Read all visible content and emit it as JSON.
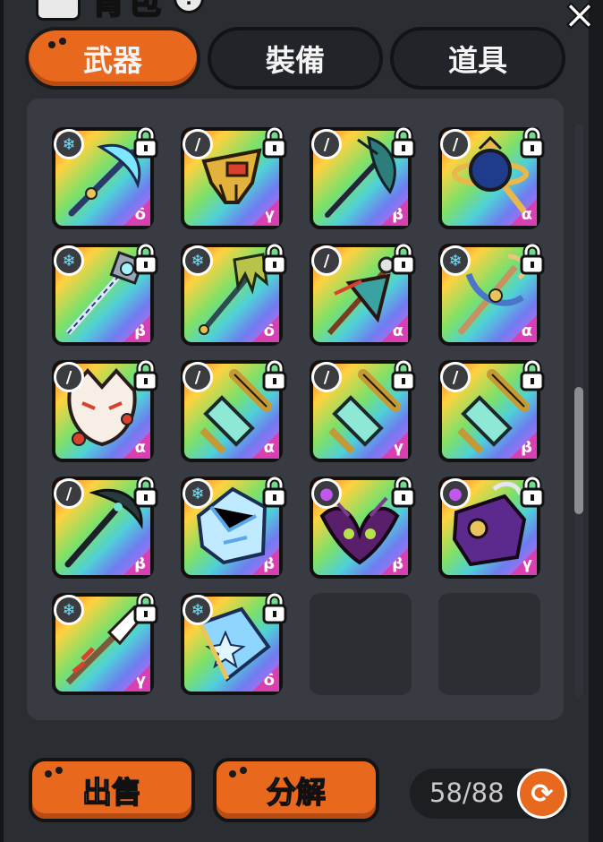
{
  "title": {
    "text": "背包",
    "info": "!"
  },
  "close": "×",
  "tabs": [
    {
      "label": "武器",
      "active": true
    },
    {
      "label": "裝備",
      "active": false
    },
    {
      "label": "道具",
      "active": false
    }
  ],
  "items": [
    {
      "icon": "ice-scythe",
      "type": "ice",
      "grade": "δ",
      "locked": true
    },
    {
      "icon": "golden-mask",
      "type": "physical",
      "grade": "γ",
      "locked": true
    },
    {
      "icon": "feather-staff",
      "type": "physical",
      "grade": "β",
      "locked": true
    },
    {
      "icon": "ringed-orb-staff",
      "type": "physical",
      "grade": "α",
      "locked": true
    },
    {
      "icon": "crystal-staff",
      "type": "ice",
      "grade": "β",
      "locked": true
    },
    {
      "icon": "claw-staff",
      "type": "ice",
      "grade": "δ",
      "locked": true
    },
    {
      "icon": "tribal-staff",
      "type": "physical",
      "grade": "α",
      "locked": true
    },
    {
      "icon": "anchor-staff",
      "type": "ice",
      "grade": "α",
      "locked": true
    },
    {
      "icon": "fox-mask",
      "type": "physical",
      "grade": "α",
      "locked": true
    },
    {
      "icon": "crystal-crossbow",
      "type": "physical",
      "grade": "α",
      "locked": true
    },
    {
      "icon": "crystal-crossbow",
      "type": "physical",
      "grade": "γ",
      "locked": true
    },
    {
      "icon": "crystal-crossbow",
      "type": "physical",
      "grade": "β",
      "locked": true
    },
    {
      "icon": "dark-scythe",
      "type": "physical",
      "grade": "β",
      "locked": true
    },
    {
      "icon": "ice-gauntlet",
      "type": "ice",
      "grade": "β",
      "locked": true
    },
    {
      "icon": "bat-wings",
      "type": "dark",
      "grade": "β",
      "locked": true
    },
    {
      "icon": "purple-gauntlet",
      "type": "dark",
      "grade": "γ",
      "locked": true
    },
    {
      "icon": "snow-staff",
      "type": "ice",
      "grade": "γ",
      "locked": true
    },
    {
      "icon": "ice-tome",
      "type": "ice",
      "grade": "δ",
      "locked": true
    },
    {
      "icon": "empty"
    },
    {
      "icon": "empty"
    }
  ],
  "buttons": {
    "sell": "出售",
    "decompose": "分解"
  },
  "capacity": {
    "text": "58/88"
  },
  "colors": {
    "accent": "#e8681e",
    "panel": "#2a2d32",
    "grade": "#d83fb0"
  }
}
